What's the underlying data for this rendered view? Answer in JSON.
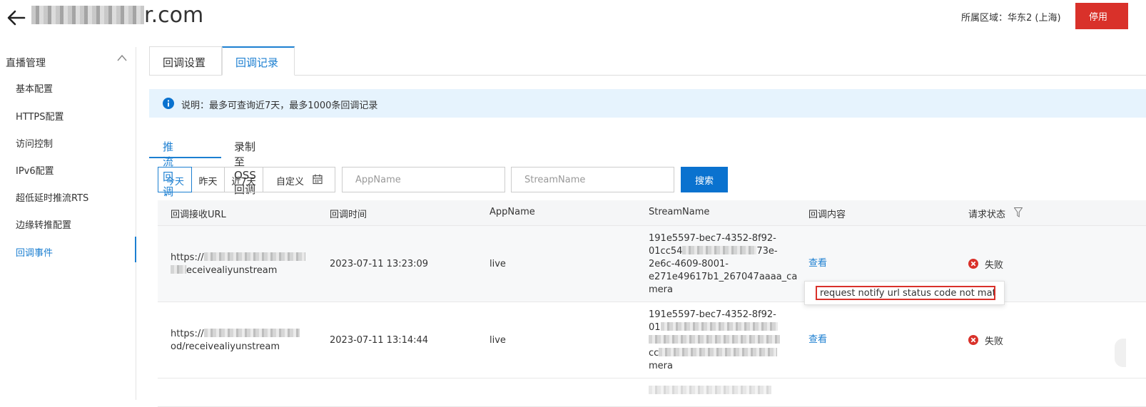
{
  "header": {
    "domain_suffix": "r.com",
    "region_label": "所属区域：华东2 (上海)",
    "stop_label": "停用"
  },
  "sidebar": {
    "group": "直播管理",
    "items": [
      {
        "label": "基本配置"
      },
      {
        "label": "HTTPS配置"
      },
      {
        "label": "访问控制"
      },
      {
        "label": "IPv6配置"
      },
      {
        "label": "超低延时推流RTS"
      },
      {
        "label": "边缘转推配置"
      },
      {
        "label": "回调事件",
        "active": true
      }
    ]
  },
  "tabs": [
    {
      "label": "回调设置"
    },
    {
      "label": "回调记录",
      "active": true
    }
  ],
  "notice": "说明：最多可查询近7天，最多1000条回调记录",
  "subtabs": [
    {
      "label": "推流回调",
      "active": true
    },
    {
      "label": "录制至OSS回调"
    }
  ],
  "filters": {
    "date_buttons": [
      "今天",
      "昨天",
      "近7天"
    ],
    "custom_label": "自定义",
    "appname_placeholder": "AppName",
    "streamname_placeholder": "StreamName",
    "search_label": "搜索"
  },
  "table": {
    "headers": [
      "回调接收URL",
      "回调时间",
      "AppName",
      "StreamName",
      "回调内容",
      "请求状态"
    ],
    "rows": [
      {
        "url_line1": "https://",
        "url_line2": "eceivealiyunstream",
        "time": "2023-07-11 13:23:09",
        "app": "live",
        "stream_line1": "191e5597-bec7-4352-8f92-",
        "stream_line2a": "01cc54",
        "stream_line2b": "73e-",
        "stream_line3": "2e6c-4609-8001-",
        "stream_line4": "e271e49617b1_267047aaaa_ca",
        "stream_line5": "mera",
        "content": "查看",
        "status": "失败"
      },
      {
        "url_line1": "https://",
        "url_line2": "od/receivealiyunstream",
        "time": "2023-07-11 13:14:44",
        "app": "live",
        "stream_line1": "191e5597-bec7-4352-8f92-",
        "stream_line2a": "01",
        "stream_line3a": "cc",
        "stream_line5": "mera",
        "content": "查看",
        "status": "失败"
      }
    ]
  },
  "tooltip": "request notify url status code not match",
  "colors": {
    "accent": "#1c7fd1",
    "danger": "#d9312a",
    "notice_bg": "#e6f3fd"
  }
}
